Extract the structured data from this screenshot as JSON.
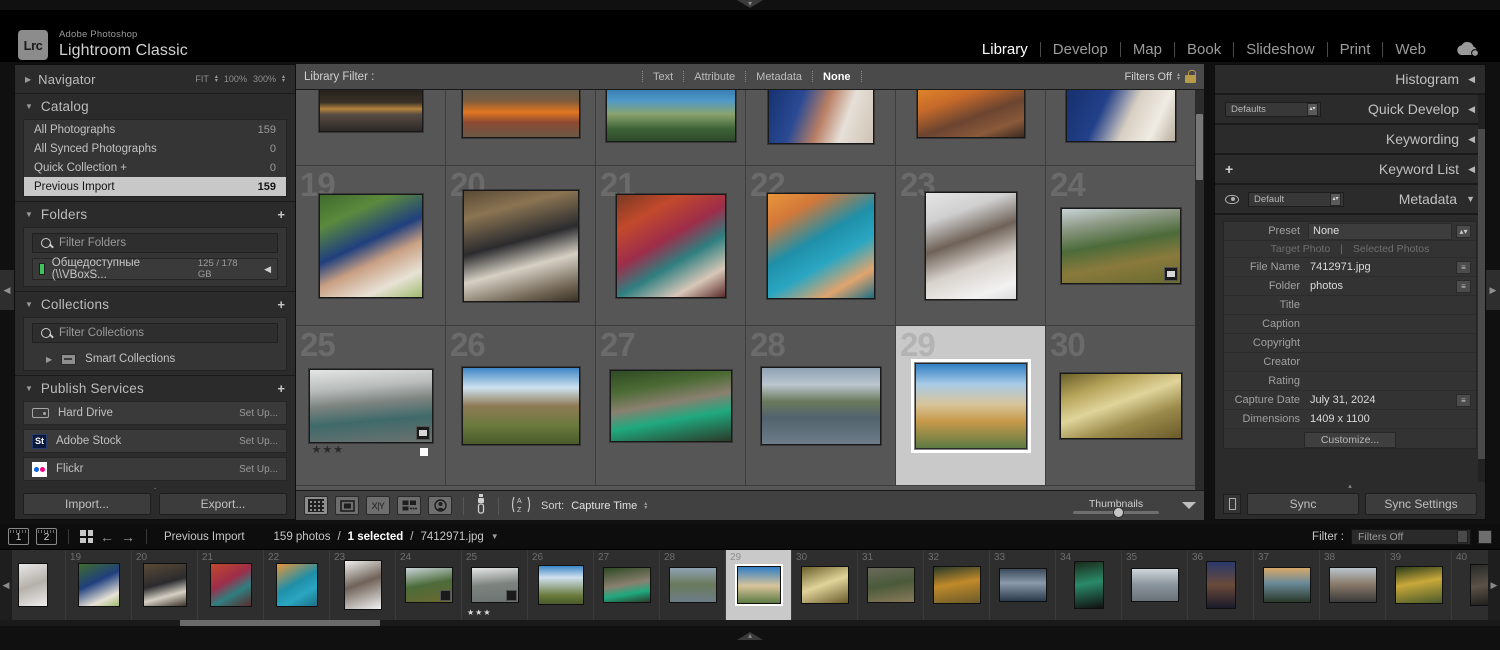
{
  "app": {
    "logo_text": "Lrc",
    "suite_name": "Adobe Photoshop",
    "product_name": "Lightroom Classic"
  },
  "modules": [
    {
      "label": "Library",
      "active": true
    },
    {
      "label": "Develop",
      "active": false
    },
    {
      "label": "Map",
      "active": false
    },
    {
      "label": "Book",
      "active": false
    },
    {
      "label": "Slideshow",
      "active": false
    },
    {
      "label": "Print",
      "active": false
    },
    {
      "label": "Web",
      "active": false
    }
  ],
  "left_panel": {
    "navigator": {
      "title": "Navigator",
      "fit": "FIT",
      "zoom_100": "100%",
      "zoom_300": "300%"
    },
    "catalog": {
      "title": "Catalog",
      "items": [
        {
          "label": "All Photographs",
          "count": "159",
          "selected": false
        },
        {
          "label": "All Synced Photographs",
          "count": "0",
          "selected": false
        },
        {
          "label": "Quick Collection  +",
          "count": "0",
          "selected": false
        },
        {
          "label": "Previous Import",
          "count": "159",
          "selected": true
        }
      ]
    },
    "folders": {
      "title": "Folders",
      "filter_placeholder": "Filter Folders",
      "entries": [
        {
          "label": "Общедоступные (\\\\VBoxS...",
          "size": "125 / 178 GB"
        }
      ]
    },
    "collections": {
      "title": "Collections",
      "filter_placeholder": "Filter Collections",
      "entries": [
        {
          "label": "Smart Collections"
        }
      ]
    },
    "publish_services": {
      "title": "Publish Services",
      "entries": [
        {
          "label": "Hard Drive",
          "action": "Set Up...",
          "icon": "hard-drive-icon"
        },
        {
          "label": "Adobe Stock",
          "action": "Set Up...",
          "icon": "adobe-stock-icon"
        },
        {
          "label": "Flickr",
          "action": "Set Up...",
          "icon": "flickr-icon"
        }
      ]
    },
    "buttons": {
      "import": "Import...",
      "export": "Export..."
    }
  },
  "library_filter": {
    "label": "Library Filter :",
    "tabs": [
      {
        "label": "Text",
        "active": false
      },
      {
        "label": "Attribute",
        "active": false
      },
      {
        "label": "Metadata",
        "active": false
      },
      {
        "label": "None",
        "active": true
      }
    ],
    "filters_state": "Filters Off"
  },
  "grid": {
    "cells": [
      {
        "index": "",
        "alt": "beach-sunset",
        "w": 104,
        "h": 48,
        "g": "linear-gradient(180deg,#1d1b18 0%,#3a3128 38%,#b5833d 52%,#584c42 64%,#2c2927 100%)",
        "partial": true
      },
      {
        "index": "",
        "alt": "orange-garden-furniture",
        "w": 118,
        "h": 54,
        "g": "linear-gradient(180deg,#5a5e52 0%,#7a5b3e 30%,#e2761f 52%,#8c4a33 72%,#6a5846 100%)",
        "partial": true
      },
      {
        "index": "",
        "alt": "harbor-town-view",
        "w": 130,
        "h": 58,
        "g": "linear-gradient(180deg,#2f73ab 0%,#4f9ac7 28%,#8aa36d 52%,#3f6438 78%,#2e4a2b 100%)",
        "partial": true
      },
      {
        "index": "",
        "alt": "bride-groom-blue-suit",
        "w": 106,
        "h": 60,
        "g": "linear-gradient(110deg,#15306e 0%,#2a4a94 30%,#b97f64 52%,#e6e0d8 72%,#cfc3b4 100%)",
        "partial": true
      },
      {
        "index": "",
        "alt": "sunset-boat-couple",
        "w": 108,
        "h": 54,
        "g": "linear-gradient(160deg,#e28a2a 0%,#c76a2a 30%,#6b4430 58%,#8a5a3a 80%,#3c2a20 100%)",
        "partial": true
      },
      {
        "index": "",
        "alt": "wedding-couple-bouquet",
        "w": 110,
        "h": 58,
        "g": "linear-gradient(115deg,#16306b 0%,#22408a 34%,#d8cfc2 58%,#f0ece4 80%,#b9ae9e 100%)",
        "partial": true
      },
      {
        "index": "19",
        "alt": "bride-groom-portrait",
        "w": 104,
        "h": 104,
        "g": "linear-gradient(155deg,#3f6b2c 0%,#5b8a3d 22%,#1f3f7e 46%,#c9a083 62%,#e8e2d6 82%,#9fbb6d 100%)"
      },
      {
        "index": "20",
        "alt": "wedding-ceremony-aisle",
        "w": 116,
        "h": 112,
        "g": "linear-gradient(165deg,#5a4a36 0%,#8a7452 20%,#2b2b2e 46%,#d6d0c4 66%,#6f6352 88%,#3a3328 100%)"
      },
      {
        "index": "21",
        "alt": "wedding-dance-confetti",
        "w": 110,
        "h": 104,
        "g": "linear-gradient(150deg,#7a3a22 0%,#c2492c 22%,#9e2d4a 44%,#2f7f80 62%,#d8c7b8 82%,#5a2a2a 100%)"
      },
      {
        "index": "22",
        "alt": "couple-boat-dock",
        "w": 108,
        "h": 106,
        "g": "linear-gradient(150deg,#e8963a 0%,#d2783a 20%,#1f8fa8 44%,#2aa6c2 62%,#e0a46e 82%,#1d6f86 100%)"
      },
      {
        "index": "23",
        "alt": "bw-woman-portrait",
        "w": 92,
        "h": 108,
        "g": "linear-gradient(160deg,#e6e6e6 0%,#cfcfcf 22%,#6f6258 44%,#d8d2cc 66%,#f2f2f2 88%,#dcdcdc 100%)"
      },
      {
        "index": "24",
        "alt": "hunter-mountain-field",
        "w": 120,
        "h": 76,
        "g": "linear-gradient(170deg,#c9d4d8 0%,#8e9a86 22%,#4c6b3a 46%,#8a7a3c 70%,#6a6a30 100%)",
        "badge": "crop-badge"
      },
      {
        "index": "25",
        "alt": "mountain-river-bw",
        "w": 124,
        "h": 74,
        "g": "linear-gradient(175deg,#e4e6e5 0%,#b8bcbb 26%,#7d8480 46%,#3f6a6a 68%,#6c7270 100%)",
        "badge": "crop-badge",
        "stars": "★★★",
        "flag": true
      },
      {
        "index": "26",
        "alt": "canyon-road-clouds",
        "w": 118,
        "h": 78,
        "g": "linear-gradient(180deg,#3d86c6 0%,#cfe1ef 26%,#8d7a55 50%,#6a7a3c 76%,#4a5a2c 100%)"
      },
      {
        "index": "27",
        "alt": "couple-green-dress",
        "w": 122,
        "h": 72,
        "g": "linear-gradient(170deg,#2e4a24 0%,#4a6a33 24%,#8a8070 46%,#1fa97e 66%,#2b3a2a 100%)"
      },
      {
        "index": "28",
        "alt": "church-reflection-pond",
        "w": 120,
        "h": 78,
        "g": "linear-gradient(180deg,#8fa2b4 0%,#bcc6cf 22%,#6a7a5c 44%,#52626e 66%,#6d7d88 100%)"
      },
      {
        "index": "29",
        "alt": "church-blue-sky-selected",
        "w": 112,
        "h": 86,
        "g": "linear-gradient(180deg,#2f7ec4 0%,#a9cbe6 24%,#d8c49a 48%,#c89a4a 68%,#5d7a44 100%)",
        "selected": true
      },
      {
        "index": "30",
        "alt": "birch-forest-autumn",
        "w": 122,
        "h": 66,
        "g": "linear-gradient(160deg,#6a5f2a 0%,#b6a45a 24%,#e0d49a 46%,#9a8a4a 70%,#6a5a2a 100%)"
      }
    ]
  },
  "toolbar": {
    "view_buttons": [
      {
        "name": "grid-view-button",
        "label": ""
      },
      {
        "name": "loupe-view-button",
        "label": ""
      },
      {
        "name": "compare-view-button",
        "label": "X|Y"
      },
      {
        "name": "survey-view-button",
        "label": ""
      },
      {
        "name": "people-view-button",
        "label": ""
      }
    ],
    "spray_label": "",
    "sort_label": "Sort:",
    "sort_value": "Capture Time",
    "thumbnails_label": "Thumbnails"
  },
  "right_panel": {
    "sections": [
      {
        "title": "Histogram",
        "collapsed": true
      },
      {
        "title": "Quick Develop",
        "collapsed": true,
        "preset": "Defaults"
      },
      {
        "title": "Keywording",
        "collapsed": true
      },
      {
        "title": "Keyword List",
        "collapsed": true
      },
      {
        "title": "Metadata",
        "collapsed": false,
        "preset": "Default"
      }
    ],
    "metadata": {
      "preset_label": "Preset",
      "preset_value": "None",
      "target_photo": "Target Photo",
      "selected_photos": "Selected Photos",
      "fields": [
        {
          "key": "File Name",
          "value": "7412971.jpg",
          "action": true
        },
        {
          "key": "Folder",
          "value": "photos",
          "action": true
        },
        {
          "key": "Title",
          "value": "",
          "action": false
        },
        {
          "key": "Caption",
          "value": "",
          "action": false
        },
        {
          "key": "Copyright",
          "value": "",
          "action": false
        },
        {
          "key": "Creator",
          "value": "",
          "action": false
        },
        {
          "key": "Rating",
          "value": "",
          "action": false
        },
        {
          "key": "Capture Date",
          "value": "July 31, 2024",
          "action": true
        },
        {
          "key": "Dimensions",
          "value": "1409 x 1100",
          "action": false
        }
      ],
      "customize_label": "Customize..."
    },
    "buttons": {
      "sync": "Sync",
      "sync_settings": "Sync Settings"
    }
  },
  "filmstrip_bar": {
    "screen1": "1",
    "screen2": "2",
    "source": "Previous Import",
    "photo_count": "159 photos",
    "selected_text": "1 selected",
    "current_file": "7412971.jpg",
    "filter_label": "Filter :",
    "filter_value": "Filters Off"
  },
  "filmstrip": {
    "items": [
      {
        "n": "",
        "alt": "bw-portrait-edge",
        "w": 30,
        "h": 44,
        "g": "linear-gradient(160deg,#e8e8e8,#b5b0aa 50%,#efefef)",
        "clip": true
      },
      {
        "n": "19",
        "alt": "bride-groom-portrait",
        "w": 42,
        "h": 44,
        "g": "linear-gradient(155deg,#3f6b2c,#1f3f7e 42%,#e8e2d6 78%,#9fbb6d)"
      },
      {
        "n": "20",
        "alt": "wedding-ceremony-aisle",
        "w": 44,
        "h": 44,
        "g": "linear-gradient(165deg,#5a4a36,#2b2b2e 46%,#d6d0c4 72%,#3a3328)"
      },
      {
        "n": "21",
        "alt": "wedding-dance-confetti",
        "w": 42,
        "h": 44,
        "g": "linear-gradient(150deg,#c2492c,#9e2d4a 40%,#2f7f80 66%,#5a2a2a)"
      },
      {
        "n": "22",
        "alt": "couple-boat-dock",
        "w": 42,
        "h": 44,
        "g": "linear-gradient(150deg,#e8963a,#1f8fa8 46%,#2aa6c2 70%,#1d6f86)"
      },
      {
        "n": "23",
        "alt": "bw-woman-portrait",
        "w": 38,
        "h": 50,
        "g": "linear-gradient(160deg,#efefef,#6f6258 46%,#f2f2f2)"
      },
      {
        "n": "24",
        "alt": "hunter-mountain-field",
        "w": 48,
        "h": 36,
        "g": "linear-gradient(170deg,#c9d4d8,#4c6b3a 48%,#6a6a30)",
        "badge": true
      },
      {
        "n": "25",
        "alt": "mountain-river-bw",
        "w": 48,
        "h": 36,
        "g": "linear-gradient(175deg,#e4e6e5,#7d8480 48%,#6c7270)",
        "badge": true,
        "stars": "★★★"
      },
      {
        "n": "26",
        "alt": "canyon-road-clouds",
        "w": 46,
        "h": 40,
        "g": "linear-gradient(180deg,#3d86c6,#cfe1ef 30%,#6a7a3c 78%,#4a5a2c)"
      },
      {
        "n": "27",
        "alt": "couple-green-dress",
        "w": 48,
        "h": 36,
        "g": "linear-gradient(170deg,#2e4a24,#8a8070 48%,#1fa97e 72%,#2b3a2a)"
      },
      {
        "n": "28",
        "alt": "church-reflection-pond",
        "w": 48,
        "h": 36,
        "g": "linear-gradient(180deg,#8fa2b4,#6a7a5c 48%,#6d7d88)"
      },
      {
        "n": "29",
        "alt": "church-blue-sky-selected",
        "w": 44,
        "h": 38,
        "g": "linear-gradient(180deg,#2f7ec4,#d8c49a 52%,#5d7a44)",
        "selected": true
      },
      {
        "n": "30",
        "alt": "birch-forest-autumn",
        "w": 48,
        "h": 38,
        "g": "linear-gradient(160deg,#6a5f2a,#e0d49a 48%,#6a5a2a)"
      },
      {
        "n": "31",
        "alt": "fisherman-river-autumn",
        "w": 48,
        "h": 36,
        "g": "linear-gradient(170deg,#6a6a5a,#4a5a3a 48%,#8a7a5a)"
      },
      {
        "n": "32",
        "alt": "autumn-lake-reflection",
        "w": 48,
        "h": 38,
        "g": "linear-gradient(170deg,#2a3a2a,#c08a2a 46%,#6a5a2a)"
      },
      {
        "n": "33",
        "alt": "dusk-beach-palm",
        "w": 48,
        "h": 34,
        "g": "linear-gradient(180deg,#3a4a5a,#8a9aaa 44%,#2a3a4a)"
      },
      {
        "n": "34",
        "alt": "green-interior-corridor",
        "w": 30,
        "h": 48,
        "g": "linear-gradient(170deg,#1a2a1a,#2a8a6a 46%,#101010)"
      },
      {
        "n": "35",
        "alt": "bw-canal-long-exposure",
        "w": 48,
        "h": 34,
        "g": "linear-gradient(180deg,#cfd6dc,#8a949c 50%,#6a7278)"
      },
      {
        "n": "36",
        "alt": "night-city-tower",
        "w": 30,
        "h": 48,
        "g": "linear-gradient(180deg,#2a3a6a,#6a4a3a 50%,#1a1a2a)"
      },
      {
        "n": "37",
        "alt": "mountain-sunrise-valley",
        "w": 48,
        "h": 36,
        "g": "linear-gradient(180deg,#d8a86a,#6a8a9a 44%,#2a3a2a)"
      },
      {
        "n": "38",
        "alt": "misty-lake-dawn",
        "w": 48,
        "h": 36,
        "g": "linear-gradient(180deg,#b8c4cc,#8a7a6a 48%,#3a3a3a)"
      },
      {
        "n": "39",
        "alt": "autumn-river-trees",
        "w": 48,
        "h": 38,
        "g": "linear-gradient(170deg,#2a3a1a,#c8a83a 44%,#4a5a2a)"
      },
      {
        "n": "40",
        "alt": "dark-tree-trunks",
        "w": 30,
        "h": 42,
        "g": "linear-gradient(170deg,#2a2a28,#5a5248 50%,#1a1a18)",
        "clip": true
      }
    ]
  }
}
